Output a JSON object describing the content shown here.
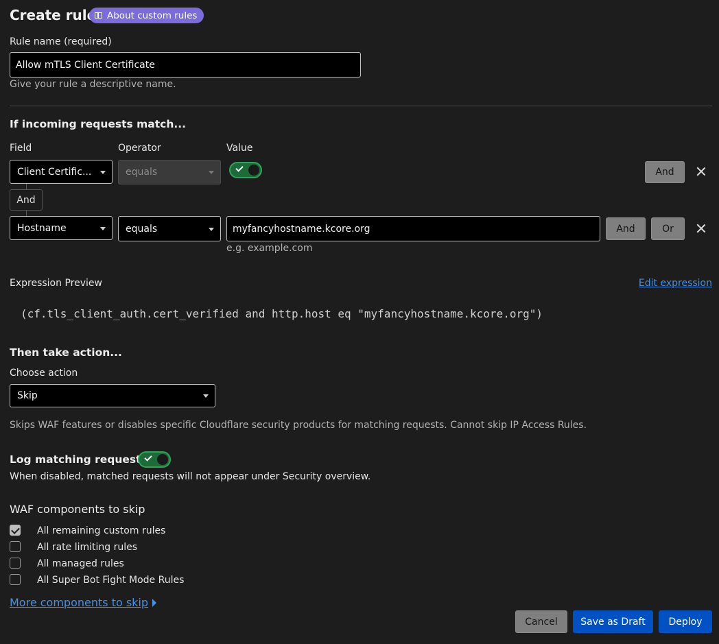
{
  "header": {
    "title": "Create rule",
    "badge_label": "About custom rules"
  },
  "rule_name": {
    "label": "Rule name (required)",
    "value": "Allow mTLS Client Certificate",
    "hint": "Give your rule a descriptive name."
  },
  "match": {
    "heading": "If incoming requests match...",
    "col_field": "Field",
    "col_operator": "Operator",
    "col_value": "Value",
    "row1": {
      "field": "Client Certific...",
      "operator": "equals",
      "value_toggle": "on",
      "and_label": "And"
    },
    "joiner": "And",
    "row2": {
      "field": "Hostname",
      "operator": "equals",
      "value": "myfancyhostname.kcore.org",
      "value_hint": "e.g. example.com",
      "and_label": "And",
      "or_label": "Or"
    }
  },
  "expression": {
    "label": "Expression Preview",
    "edit_link": "Edit expression",
    "text": "(cf.tls_client_auth.cert_verified and http.host eq \"myfancyhostname.kcore.org\")"
  },
  "action": {
    "heading": "Then take action...",
    "label": "Choose action",
    "selected": "Skip",
    "description": "Skips WAF features or disables specific Cloudflare security products for matching requests. Cannot skip IP Access Rules."
  },
  "logging": {
    "heading": "Log matching requests",
    "toggle": "on",
    "hint": "When disabled, matched requests will not appear under Security overview."
  },
  "waf": {
    "heading": "WAF components to skip",
    "items": [
      {
        "label": "All remaining custom rules",
        "checked": true
      },
      {
        "label": "All rate limiting rules",
        "checked": false
      },
      {
        "label": "All managed rules",
        "checked": false
      },
      {
        "label": "All Super Bot Fight Mode Rules",
        "checked": false
      }
    ],
    "more_link": "More components to skip"
  },
  "footer": {
    "cancel": "Cancel",
    "save_draft": "Save as Draft",
    "deploy": "Deploy"
  },
  "colors": {
    "accent_blue": "#0051c3",
    "badge_purple": "#7b6cd9",
    "toggle_green": "#2da558",
    "link_blue": "#4a8fe0"
  }
}
